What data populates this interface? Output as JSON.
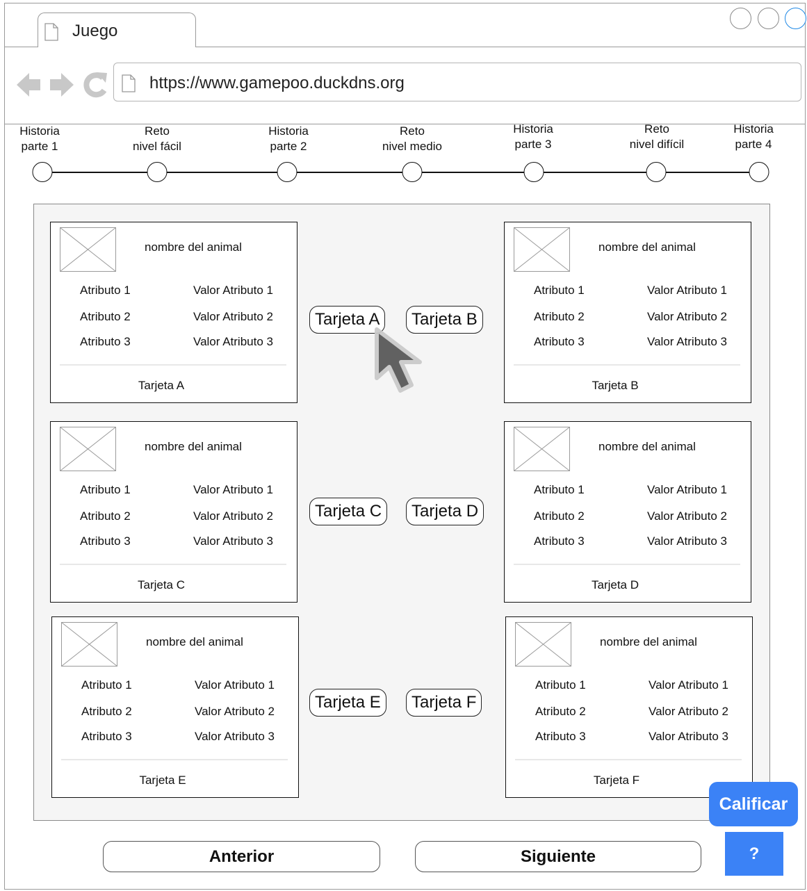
{
  "browser": {
    "tab_title": "Juego",
    "url": "https://www.gamepoo.duckdns.org",
    "window_controls": [
      "circle",
      "circle",
      "circle-blue"
    ],
    "nav_icons": [
      "back-arrow-icon",
      "forward-arrow-icon",
      "reload-icon"
    ],
    "accent_color": "#1e88e5"
  },
  "progress": {
    "current_index": 1,
    "steps": [
      {
        "line1": "Historia",
        "line2": "parte 1"
      },
      {
        "line1": "Reto",
        "line2": "nivel fácil"
      },
      {
        "line1": "Historia",
        "line2": "parte 2"
      },
      {
        "line1": "Reto",
        "line2": "nivel medio"
      },
      {
        "line1": "Historia",
        "line2": "parte 3"
      },
      {
        "line1": "Reto",
        "line2": "nivel difícil"
      },
      {
        "line1": "Historia",
        "line2": "parte 4"
      }
    ]
  },
  "cards": [
    {
      "name": "nombre del animal",
      "caption": "Tarjeta A",
      "rows": [
        {
          "attr": "Atributo 1",
          "val": "Valor Atributo 1"
        },
        {
          "attr": "Atributo 2",
          "val": "Valor Atributo 2"
        },
        {
          "attr": "Atributo 3",
          "val": "Valor Atributo 3"
        }
      ]
    },
    {
      "name": "nombre del animal",
      "caption": "Tarjeta B",
      "rows": [
        {
          "attr": "Atributo 1",
          "val": "Valor Atributo 1"
        },
        {
          "attr": "Atributo 2",
          "val": "Valor Atributo 2"
        },
        {
          "attr": "Atributo 3",
          "val": "Valor Atributo 3"
        }
      ]
    },
    {
      "name": "nombre del animal",
      "caption": "Tarjeta C",
      "rows": [
        {
          "attr": "Atributo 1",
          "val": "Valor Atributo 1"
        },
        {
          "attr": "Atributo 2",
          "val": "Valor Atributo 2"
        },
        {
          "attr": "Atributo 3",
          "val": "Valor Atributo 3"
        }
      ]
    },
    {
      "name": "nombre del animal",
      "caption": "Tarjeta D",
      "rows": [
        {
          "attr": "Atributo 1",
          "val": "Valor Atributo 1"
        },
        {
          "attr": "Atributo 2",
          "val": "Valor Atributo 2"
        },
        {
          "attr": "Atributo 3",
          "val": "Valor Atributo 3"
        }
      ]
    },
    {
      "name": "nombre del animal",
      "caption": "Tarjeta E",
      "rows": [
        {
          "attr": "Atributo 1",
          "val": "Valor Atributo 1"
        },
        {
          "attr": "Atributo 2",
          "val": "Valor Atributo 2"
        },
        {
          "attr": "Atributo 3",
          "val": "Valor Atributo 3"
        }
      ]
    },
    {
      "name": "nombre del animal",
      "caption": "Tarjeta F",
      "rows": [
        {
          "attr": "Atributo 1",
          "val": "Valor Atributo 1"
        },
        {
          "attr": "Atributo 2",
          "val": "Valor Atributo 2"
        },
        {
          "attr": "Atributo 3",
          "val": "Valor Atributo 3"
        }
      ]
    }
  ],
  "choice_buttons": [
    "Tarjeta A",
    "Tarjeta B",
    "Tarjeta C",
    "Tarjeta D",
    "Tarjeta E",
    "Tarjeta F"
  ],
  "footer": {
    "prev_label": "Anterior",
    "next_label": "Siguiente",
    "grade_label": "Calificar",
    "help_label": "?",
    "action_color": "#3b82f6"
  }
}
